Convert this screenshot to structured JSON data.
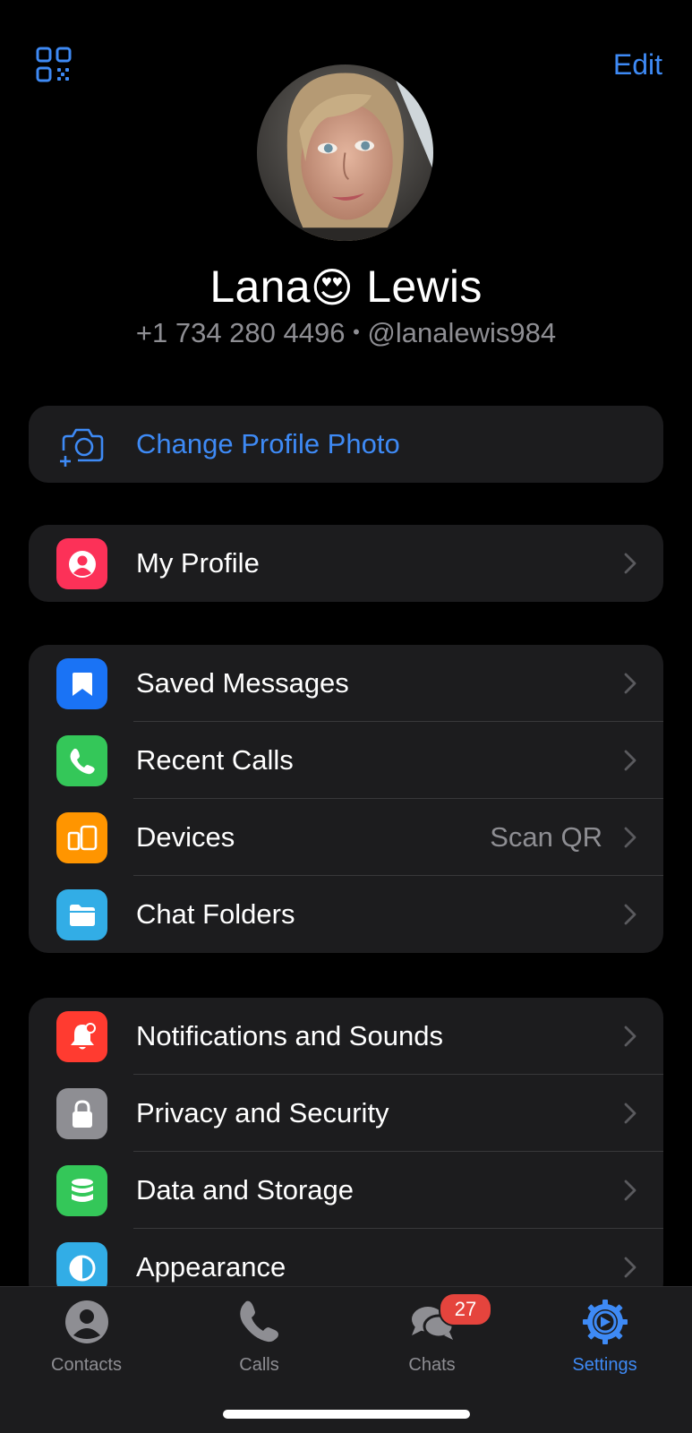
{
  "header": {
    "qr_icon": "qr-code-icon",
    "edit_label": "Edit"
  },
  "profile": {
    "name_first": "Lana",
    "name_emoji": "😍",
    "name_last": "Lewis",
    "phone": "+1 734 280 4496",
    "separator": "•",
    "username": "@lanalewis984"
  },
  "change_photo": {
    "label": "Change Profile Photo",
    "icon": "camera-add-icon"
  },
  "group_profile": [
    {
      "label": "My Profile",
      "icon": "person-icon",
      "color": "#fc3158"
    }
  ],
  "group_main": [
    {
      "label": "Saved Messages",
      "icon": "bookmark-icon",
      "color": "#1a73f5"
    },
    {
      "label": "Recent Calls",
      "icon": "phone-icon",
      "color": "#34c759"
    },
    {
      "label": "Devices",
      "icon": "devices-icon",
      "color": "#ff9500",
      "value": "Scan QR"
    },
    {
      "label": "Chat Folders",
      "icon": "folder-icon",
      "color": "#32ade6"
    }
  ],
  "group_settings": [
    {
      "label": "Notifications and Sounds",
      "icon": "bell-icon",
      "color": "#ff3b30"
    },
    {
      "label": "Privacy and Security",
      "icon": "lock-icon",
      "color": "#8e8e93"
    },
    {
      "label": "Data and Storage",
      "icon": "database-icon",
      "color": "#34c759"
    },
    {
      "label": "Appearance",
      "icon": "contrast-icon",
      "color": "#32ade6"
    }
  ],
  "tabbar": {
    "tabs": [
      {
        "label": "Contacts",
        "icon": "person-circle-icon"
      },
      {
        "label": "Calls",
        "icon": "phone-icon"
      },
      {
        "label": "Chats",
        "icon": "chat-bubbles-icon",
        "badge": "27"
      },
      {
        "label": "Settings",
        "icon": "gear-icon",
        "active": true
      }
    ]
  },
  "colors": {
    "accent": "#3e8af5",
    "background": "#000000",
    "cell": "#1c1c1e",
    "secondary_text": "#8e8e93",
    "badge": "#e5443d"
  }
}
